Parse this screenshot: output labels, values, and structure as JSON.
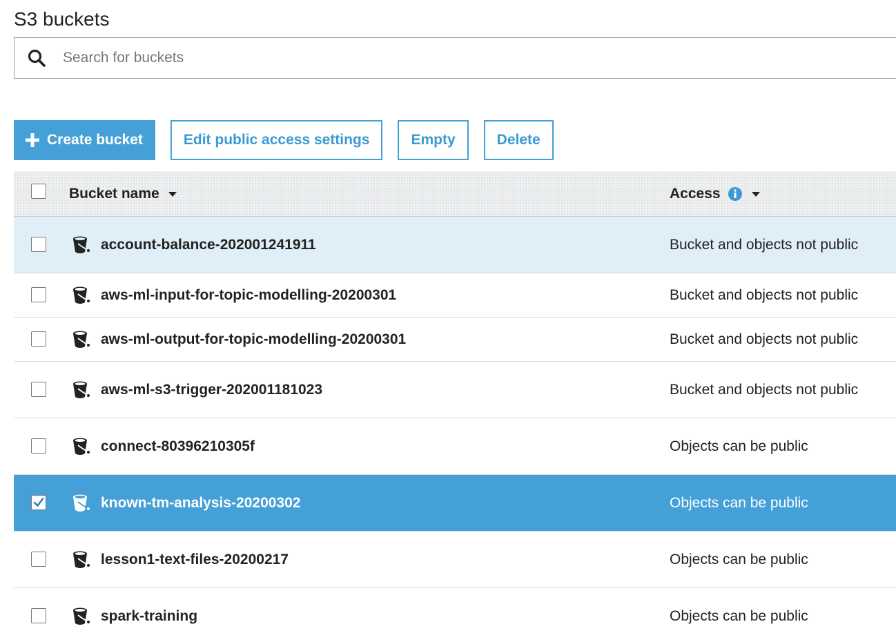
{
  "page": {
    "title": "S3 buckets"
  },
  "search": {
    "placeholder": "Search for buckets",
    "value": ""
  },
  "toolbar": {
    "create_label": "Create bucket",
    "edit_access_label": "Edit public access settings",
    "empty_label": "Empty",
    "delete_label": "Delete"
  },
  "table": {
    "headers": {
      "name": "Bucket name",
      "access": "Access"
    },
    "rows": [
      {
        "name": "account-balance-202001241911",
        "access": "Bucket and objects not public",
        "checked": false,
        "state": "hover"
      },
      {
        "name": "aws-ml-input-for-topic-modelling-20200301",
        "access": "Bucket and objects not public",
        "checked": false,
        "state": "normal"
      },
      {
        "name": "aws-ml-output-for-topic-modelling-20200301",
        "access": "Bucket and objects not public",
        "checked": false,
        "state": "normal"
      },
      {
        "name": "aws-ml-s3-trigger-202001181023",
        "access": "Bucket and objects not public",
        "checked": false,
        "state": "normal"
      },
      {
        "name": "connect-80396210305f",
        "access": "Objects can be public",
        "checked": false,
        "state": "normal"
      },
      {
        "name": "known-tm-analysis-20200302",
        "access": "Objects can be public",
        "checked": true,
        "state": "selected"
      },
      {
        "name": "lesson1-text-files-20200217",
        "access": "Objects can be public",
        "checked": false,
        "state": "normal"
      },
      {
        "name": "spark-training",
        "access": "Objects can be public",
        "checked": false,
        "state": "normal"
      }
    ]
  },
  "icons": {
    "search": "search-icon",
    "create": "plus-icon",
    "sort": "caret-down-icon",
    "info": "info-icon",
    "bucket": "bucket-icon",
    "check": "check-icon"
  },
  "colors": {
    "accent": "#44a0d6",
    "hover_row": "#dfeef7",
    "selected_row": "#44a0d6"
  }
}
